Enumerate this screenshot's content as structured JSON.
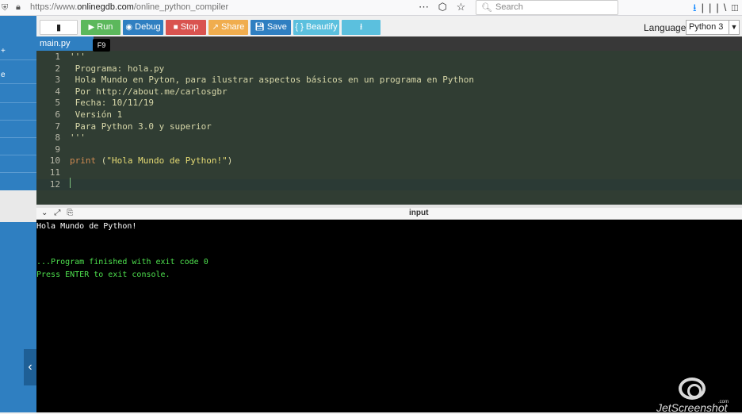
{
  "browser": {
    "url_prefix": "https://www.",
    "url_domain": "onlinegdb.com",
    "url_path": "/online_python_compiler",
    "search_placeholder": "Search",
    "menu_icon": "more-icon",
    "icons": [
      "shield-icon",
      "lock-icon",
      "bookmark-icon",
      "star-icon",
      "download-icon",
      "library-icon",
      "sidebar-icon"
    ]
  },
  "toolbar": {
    "run_label": "Run",
    "debug_label": "Debug",
    "stop_label": "Stop",
    "share_label": "Share",
    "save_label": "Save",
    "beautify_label": "{ } Beautify",
    "tooltip": "F9",
    "language_label": "Language",
    "language_value": "Python 3",
    "colors": {
      "run": "#5cb85c",
      "debug": "#2f7fc1",
      "stop": "#d9534f",
      "share": "#f0ad4e",
      "save": "#2f7fc1",
      "beautify": "#5bc0de",
      "download": "#5bc0de"
    }
  },
  "tab": {
    "filename": "main.py"
  },
  "editor": {
    "lines": [
      {
        "n": "1",
        "text": "'''"
      },
      {
        "n": "2",
        "text": " Programa: hola.py"
      },
      {
        "n": "3",
        "text": " Hola Mundo en Pyton, para ilustrar aspectos básicos en un programa en Python"
      },
      {
        "n": "4",
        "text": " Por http://about.me/carlosgbr"
      },
      {
        "n": "5",
        "text": " Fecha: 10/11/19"
      },
      {
        "n": "6",
        "text": " Versión 1"
      },
      {
        "n": "7",
        "text": " Para Python 3.0 y superior"
      },
      {
        "n": "8",
        "text": "'''"
      },
      {
        "n": "9",
        "text": ""
      },
      {
        "n": "10",
        "kw": "print",
        "rest": " (",
        "str": "\"Hola Mundo de Python!\"",
        "end": ")"
      },
      {
        "n": "11",
        "text": ""
      },
      {
        "n": "12",
        "text": ""
      }
    ]
  },
  "io": {
    "title": "input"
  },
  "console": {
    "output_line": "Hola Mundo de Python!",
    "exit_line": "...Program finished with exit code 0",
    "press_line": "Press ENTER to exit console."
  },
  "watermark": {
    "text": "JetScreenshot",
    "suffix": ".com"
  }
}
